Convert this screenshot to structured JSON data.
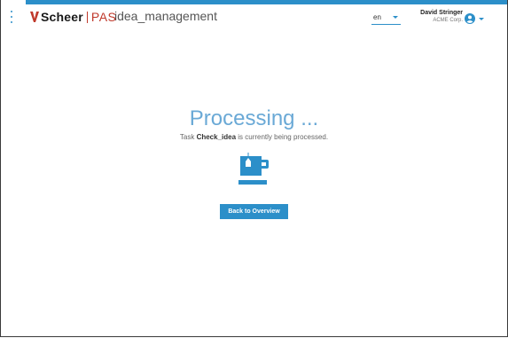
{
  "header": {
    "logo_brand": "Scheer",
    "logo_product": "PAS",
    "app_name": "idea_management",
    "language": "en",
    "user_name": "David Stringer",
    "user_org": "ACME Corp."
  },
  "main": {
    "title": "Processing ...",
    "subtitle_prefix": "Task ",
    "task_name": "Check_idea",
    "subtitle_suffix": " is currently being processed.",
    "back_button_label": "Back to Overview"
  },
  "colors": {
    "accent": "#2c8fc9",
    "title": "#6aa9d6",
    "brand_red": "#c0392b"
  },
  "icons": {
    "menu": "kebab-menu-icon",
    "avatar": "user-circle-icon",
    "status": "tea-cup-icon"
  }
}
